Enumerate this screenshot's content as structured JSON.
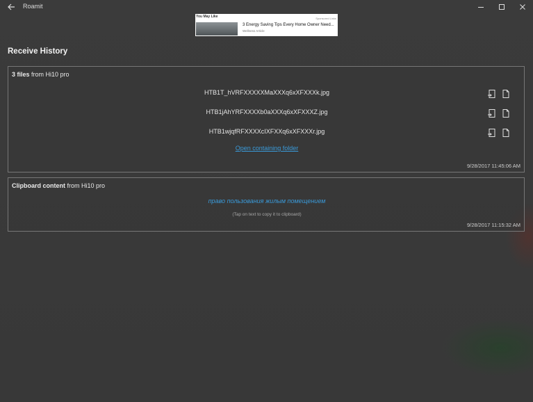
{
  "titlebar": {
    "app_title": "Roamit"
  },
  "ad": {
    "label": "You May Like",
    "sponsored": "Sponsored Links",
    "headline": "3 Energy Saving Tips Every Home Owner Need...",
    "source": "Wellness Article"
  },
  "page": {
    "title": "Receive History"
  },
  "files_card": {
    "count": "3 files",
    "from_text": "from Hi10 pro",
    "files": [
      {
        "name": "HTB1T_hVRFXXXXXMaXXXq6xXFXXXk.jpg"
      },
      {
        "name": "HTB1jAhYRFXXXXb0aXXXq6xXFXXXZ.jpg"
      },
      {
        "name": "HTB1wjqfRFXXXXcIXFXXq6xXFXXXr.jpg"
      }
    ],
    "open_folder_label": "Open containing folder",
    "timestamp": "9/28/2017 11:45:06 AM"
  },
  "clipboard_card": {
    "title": "Clipboard content",
    "from_text": "from Hi10 pro",
    "content": "право пользования жилым помещением",
    "hint": "(Tap on text to copy it to clipboard)",
    "timestamp": "9/28/2017 11:15:32 AM"
  },
  "icons": {
    "back": "back-arrow-icon",
    "minimize": "minimize-icon",
    "maximize": "maximize-icon",
    "close": "close-icon",
    "open_with": "open-with-icon",
    "open_file": "open-file-icon"
  },
  "colors": {
    "accent": "#3a9ad9",
    "background": "#3a3a3a",
    "card_border": "#777777"
  }
}
